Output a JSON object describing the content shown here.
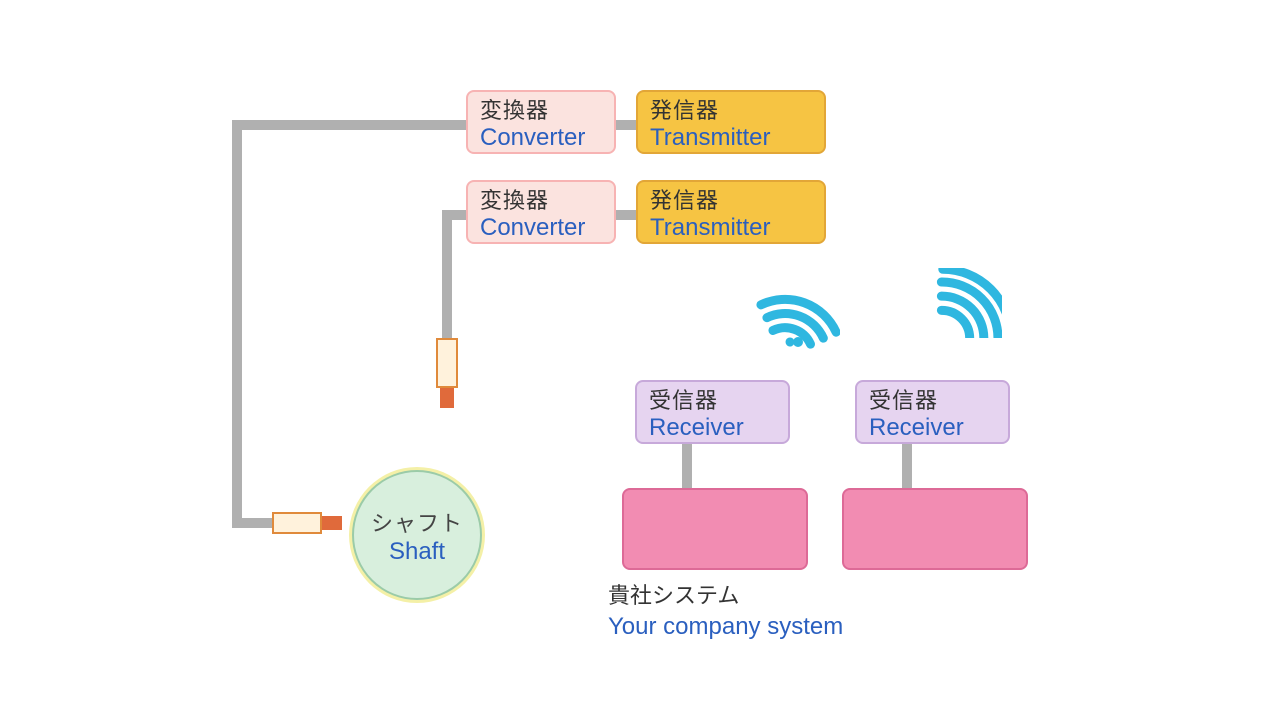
{
  "converter1": {
    "jp": "変換器",
    "en": "Converter"
  },
  "converter2": {
    "jp": "変換器",
    "en": "Converter"
  },
  "transmitter1": {
    "jp": "発信器",
    "en": "Transmitter"
  },
  "transmitter2": {
    "jp": "発信器",
    "en": "Transmitter"
  },
  "receiver1": {
    "jp": "受信器",
    "en": "Receiver"
  },
  "receiver2": {
    "jp": "受信器",
    "en": "Receiver"
  },
  "shaft": {
    "jp": "シャフト",
    "en": "Shaft"
  },
  "system": {
    "jp": "貴社システム",
    "en": "Your company system"
  }
}
